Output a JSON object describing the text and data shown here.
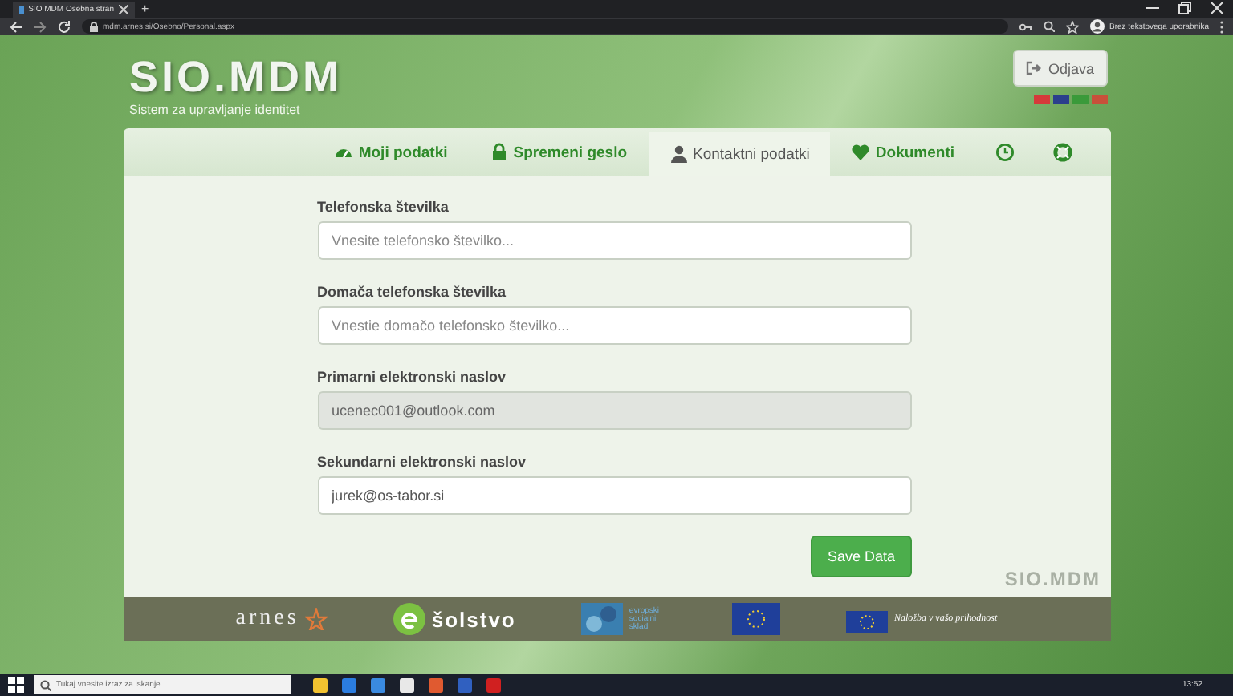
{
  "browser": {
    "tab_title": "SIO MDM Osebna stran",
    "new_tab": "+",
    "address": "mdm.arnes.si/Osebno/Personal.aspx",
    "profile": "Brez tekstovega uporabnika"
  },
  "header": {
    "logo_text": "SIO.MDM",
    "subtitle": "Sistem za upravljanje identitet",
    "logout": "Odjava",
    "flags": [
      {
        "color": "#d63a3a"
      },
      {
        "color": "#2b3f8c"
      },
      {
        "color": "#3a9a3a"
      },
      {
        "color": "#c8503a"
      }
    ]
  },
  "nav": [
    {
      "kind": "text",
      "label": "Moji podatki",
      "selected": false
    },
    {
      "kind": "text",
      "label": "Spremeni geslo",
      "selected": false
    },
    {
      "kind": "text",
      "label": "Kontaktni podatki",
      "selected": true
    },
    {
      "kind": "text",
      "label": "Dokumenti",
      "selected": false
    },
    {
      "kind": "icon",
      "selected": false
    },
    {
      "kind": "icon",
      "selected": false
    }
  ],
  "form": [
    {
      "label": "Telefonska številka",
      "placeholder": "Vnesite telefonsko številko...",
      "disabled": false
    },
    {
      "label": "Domača telefonska številka",
      "placeholder": "Vnestie domačo telefonsko številko...",
      "disabled": false
    },
    {
      "label": "Primarni elektronski naslov",
      "value": "ucenec001@outlook.com",
      "disabled": true
    },
    {
      "label": "Sekundarni elektronski naslov",
      "value": "jurek@os-tabor.si",
      "disabled": false
    }
  ],
  "save_button": "Save Data",
  "watermark_logo": "SIO.MDM",
  "footer": {
    "arnes": "arnes",
    "solstvo": "šolstvo",
    "esf": "evropski socialni sklad",
    "eu_slogan": "Naložba v vašo prihodnost"
  },
  "taskbar": {
    "search_placeholder": "Tukaj vnesite izraz za iskanje",
    "time": "13:52"
  }
}
